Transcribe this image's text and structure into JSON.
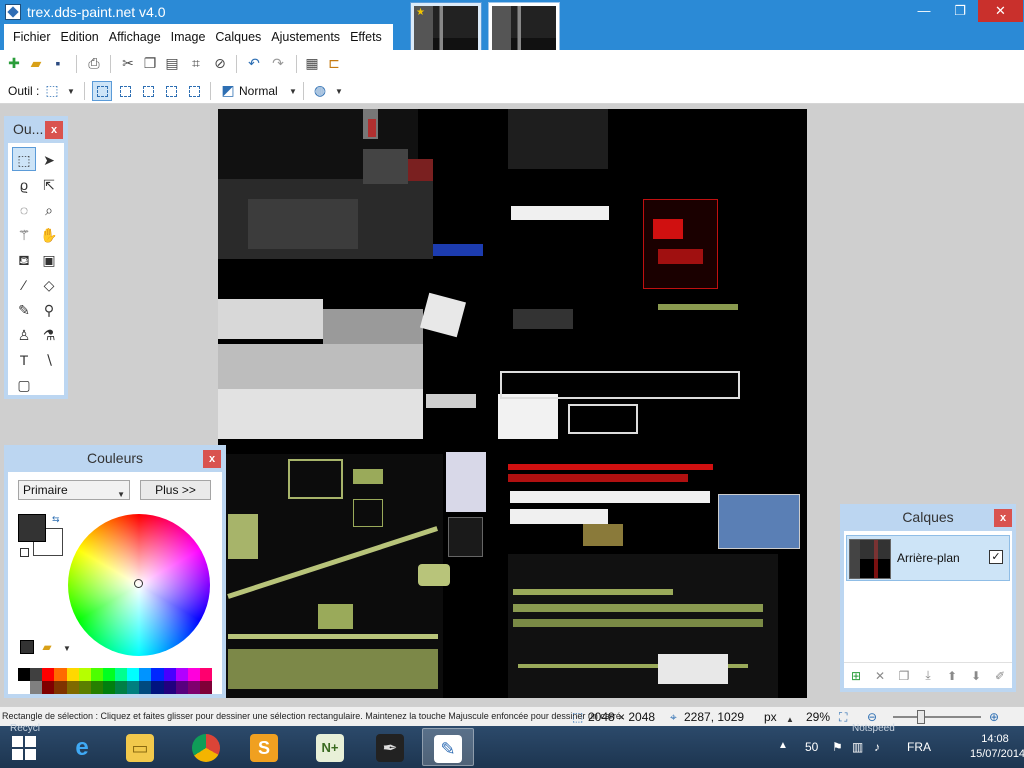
{
  "window": {
    "title": "trex.dds-paint.net v4.0",
    "controls": {
      "minimize": "—",
      "maximize": "❐",
      "close": "✕"
    }
  },
  "menu": [
    "Fichier",
    "Edition",
    "Affichage",
    "Image",
    "Calques",
    "Ajustements",
    "Effets"
  ],
  "toolbar": {
    "tool_label": "Outil :",
    "blend_mode": "Normal"
  },
  "tools_panel": {
    "title": "Ou...",
    "close": "x",
    "tools": [
      {
        "name": "rectangle-select-icon",
        "glyph": "⬚"
      },
      {
        "name": "move-selection-icon",
        "glyph": "➤"
      },
      {
        "name": "lasso-select-icon",
        "glyph": "ϱ"
      },
      {
        "name": "move-selected-icon",
        "glyph": "⇱"
      },
      {
        "name": "ellipse-select-icon",
        "glyph": "◌"
      },
      {
        "name": "zoom-icon",
        "glyph": "⌕"
      },
      {
        "name": "magic-wand-icon",
        "glyph": "⚚"
      },
      {
        "name": "pan-icon",
        "glyph": "✋"
      },
      {
        "name": "paint-bucket-icon",
        "glyph": "⛾"
      },
      {
        "name": "gradient-icon",
        "glyph": "▣"
      },
      {
        "name": "paintbrush-icon",
        "glyph": "∕"
      },
      {
        "name": "eraser-icon",
        "glyph": "◇"
      },
      {
        "name": "pencil-icon",
        "glyph": "✎"
      },
      {
        "name": "color-picker-icon",
        "glyph": "⚲"
      },
      {
        "name": "clone-stamp-icon",
        "glyph": "♙"
      },
      {
        "name": "recolor-icon",
        "glyph": "⚗"
      },
      {
        "name": "text-icon",
        "glyph": "T"
      },
      {
        "name": "line-curve-icon",
        "glyph": "∖"
      },
      {
        "name": "shapes-icon",
        "glyph": "▢"
      }
    ]
  },
  "colors_panel": {
    "title": "Couleurs",
    "close": "x",
    "mode": "Primaire",
    "more_button": "Plus >>",
    "primary_color": "#333333",
    "secondary_color": "#ffffff",
    "palette": [
      "#000000",
      "#404040",
      "#ff0000",
      "#ff6a00",
      "#ffd800",
      "#b6ff00",
      "#4cff00",
      "#00ff21",
      "#00ff90",
      "#00ffff",
      "#0094ff",
      "#0026ff",
      "#4800ff",
      "#b200ff",
      "#ff00dc",
      "#ff006e",
      "#ffffff",
      "#808080",
      "#7f0000",
      "#7f3300",
      "#7f6a00",
      "#5b7f00",
      "#267f00",
      "#007f0e",
      "#007f46",
      "#007f7f",
      "#004a7f",
      "#00137f",
      "#21007f",
      "#57007f",
      "#7f006e",
      "#7f0037"
    ]
  },
  "layers_panel": {
    "title": "Calques",
    "close": "x",
    "layer_name": "Arrière-plan",
    "visible_mark": "✓",
    "actions": [
      {
        "name": "add-layer-icon",
        "glyph": "⊞"
      },
      {
        "name": "delete-layer-icon",
        "glyph": "✕"
      },
      {
        "name": "duplicate-layer-icon",
        "glyph": "❐"
      },
      {
        "name": "merge-layer-down-icon",
        "glyph": "⤓"
      },
      {
        "name": "move-layer-up-icon",
        "glyph": "⬆"
      },
      {
        "name": "move-layer-down-icon",
        "glyph": "⬇"
      },
      {
        "name": "layer-properties-icon",
        "glyph": "✐"
      }
    ]
  },
  "status": {
    "hint": "Rectangle de sélection : Cliquez et faites glisser pour dessiner une sélection rectangulaire. Maintenez la touche Majuscule enfoncée pour dessiner un carré.",
    "image_size": "2048 × 2048",
    "cursor_pos": "2287, 1029",
    "unit": "px",
    "zoom": "29%",
    "zoom_level": 0.29
  },
  "taskbar": {
    "desktop_left": "Recycl",
    "desktop_right": "Notspeed",
    "tray_count": "50",
    "language": "FRA",
    "time": "14:08",
    "date": "15/07/2014"
  }
}
